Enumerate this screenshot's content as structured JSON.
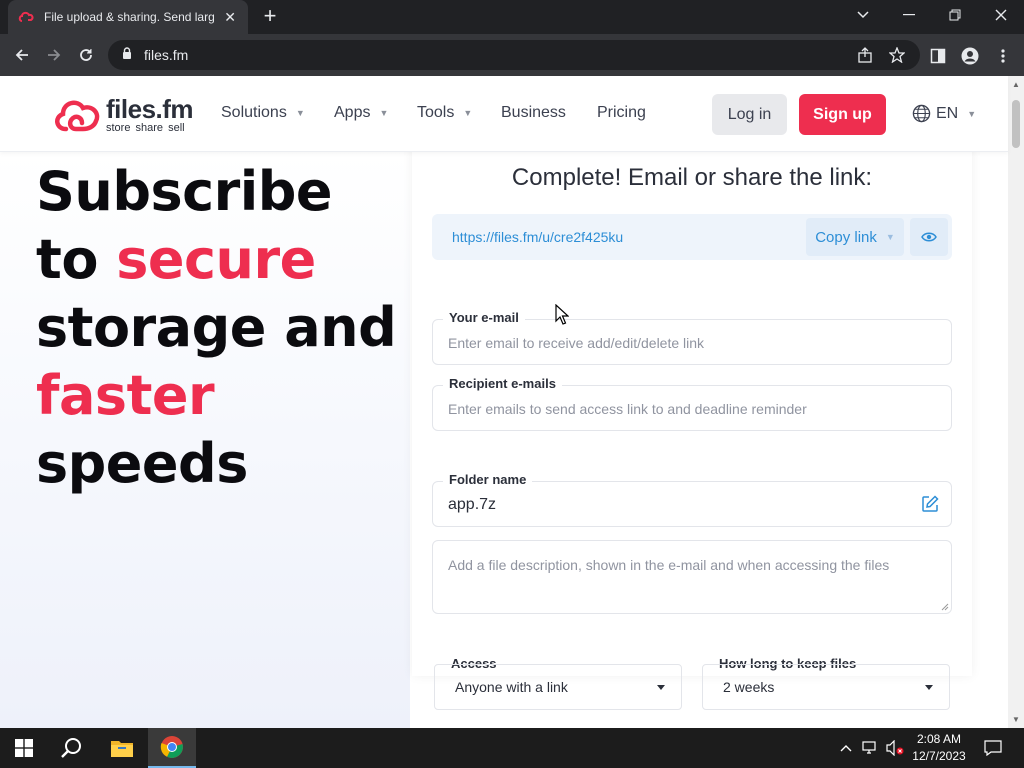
{
  "browser": {
    "tab_title": "File upload & sharing. Send large files",
    "tab_close": "✕",
    "new_tab": "+",
    "url": "files.fm"
  },
  "header": {
    "logo_name": "files.fm",
    "logo_tagline": "store share sell",
    "nav": [
      "Solutions",
      "Apps",
      "Tools",
      "Business",
      "Pricing"
    ],
    "login": "Log in",
    "signup": "Sign up",
    "language": "EN",
    "brand_color": "#ee2e4f"
  },
  "hero": {
    "line1": "Subscribe",
    "line2_pre": "to ",
    "line2_accent": "secure",
    "line3": "storage and",
    "line4_accent": "faster",
    "line5": "speeds"
  },
  "share": {
    "heading": "Complete! Email or share the link:",
    "link": "https://files.fm/u/cre2f425ku",
    "copy_label": "Copy link",
    "your_email_label": "Your e-mail",
    "your_email_placeholder": "Enter email to receive add/edit/delete link",
    "recipients_label": "Recipient e-mails",
    "recipients_placeholder": "Enter emails to send access link to and deadline reminder",
    "folder_label": "Folder name",
    "folder_value": "app.7z",
    "description_placeholder": "Add a file description, shown in the e-mail and when accessing the files",
    "access_label": "Access",
    "access_value": "Anyone with a link",
    "keep_label": "How long to keep files",
    "keep_value": "2 weeks"
  },
  "taskbar": {
    "time": "2:08 AM",
    "date": "12/7/2023"
  }
}
